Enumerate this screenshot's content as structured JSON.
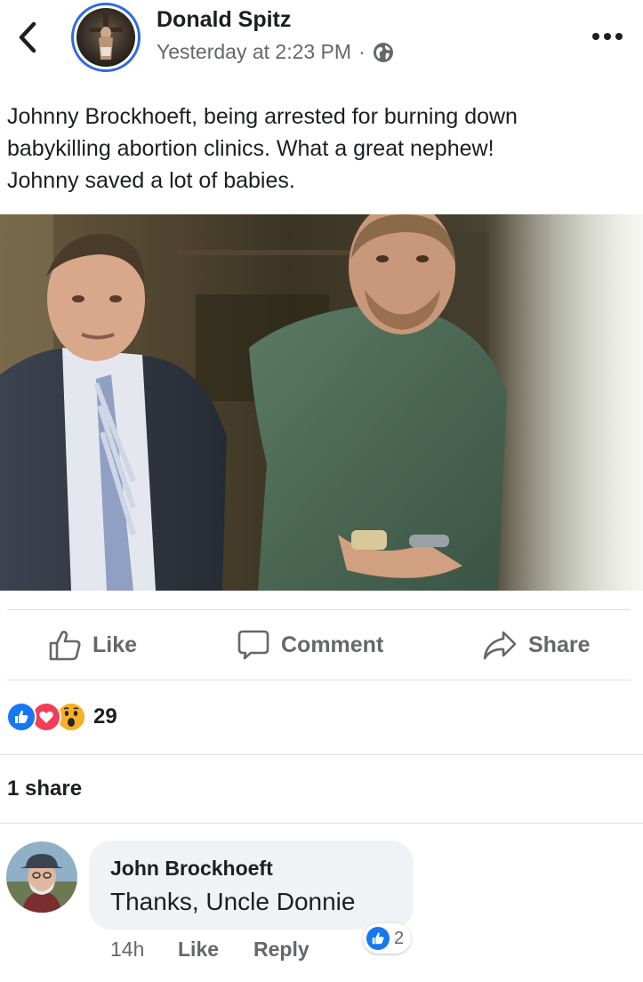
{
  "post": {
    "author": "Donald Spitz",
    "timestamp": "Yesterday at 2:23 PM",
    "separator": "·",
    "privacy_icon": "globe-icon",
    "text": "Johnny Brockhoeft, being  arrested for burning down\nbabykilling abortion clinics. What a great nephew!\nJohnny saved a lot of babies."
  },
  "actions": {
    "like": "Like",
    "comment": "Comment",
    "share": "Share"
  },
  "reactions": {
    "types": [
      "like",
      "love",
      "wow"
    ],
    "count": "29"
  },
  "shares": {
    "label": "1 share"
  },
  "comment": {
    "author": "John Brockhoeft",
    "text": "Thanks, Uncle Donnie",
    "time": "14h",
    "like_label": "Like",
    "reply_label": "Reply",
    "like_count": "2"
  },
  "colors": {
    "accent": "#2d6be0",
    "like_blue": "#1877f2",
    "love_red": "#f33e58",
    "wow_yellow": "#f7b125",
    "secondary_text": "#65676b",
    "divider": "#dddfe2",
    "bubble": "#f0f2f5"
  }
}
